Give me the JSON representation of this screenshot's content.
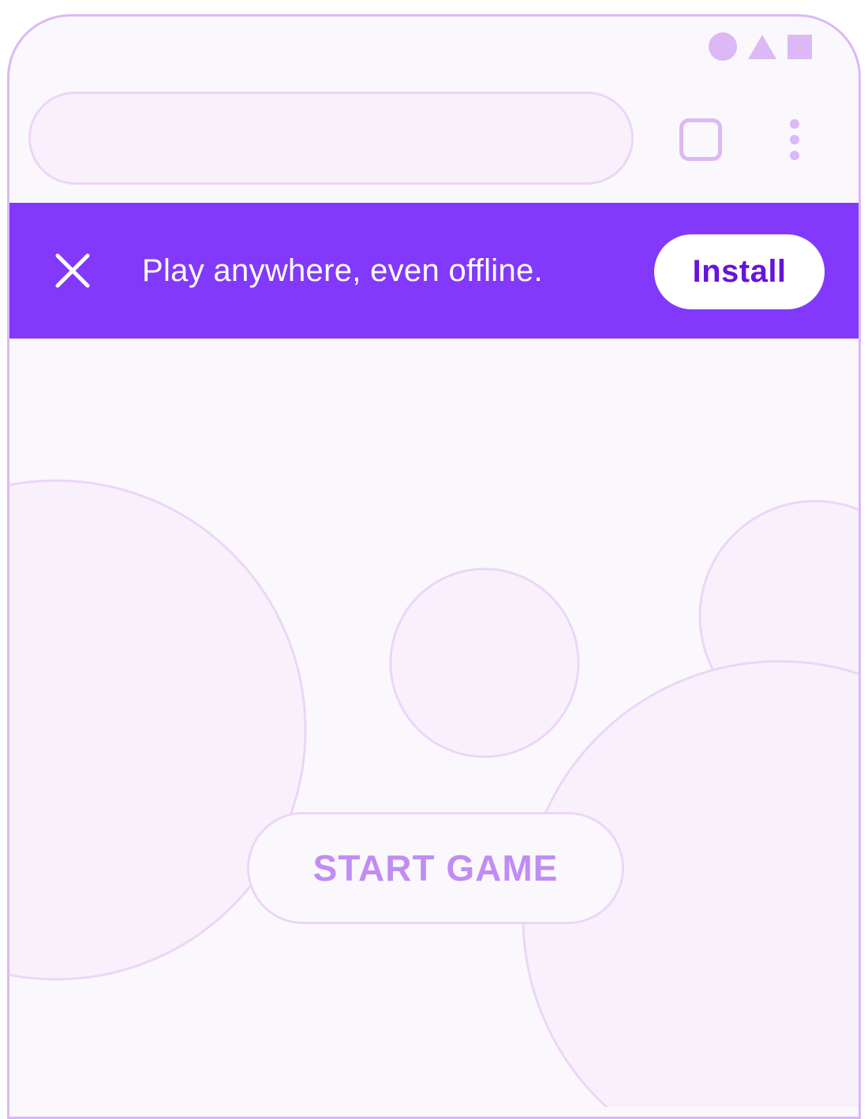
{
  "banner": {
    "message": "Play anywhere, even offline.",
    "install_label": "Install",
    "close_icon": "close-icon"
  },
  "toolbar": {
    "url": "",
    "tabs_icon": "tabs-icon",
    "menu_icon": "more-vert-icon"
  },
  "status_bar": {
    "icons": [
      "circle-icon",
      "triangle-icon",
      "square-icon"
    ]
  },
  "game": {
    "start_label": "START GAME"
  },
  "colors": {
    "accent": "#8239fb",
    "install_text": "#6714d9",
    "outline": "#dcb8f6",
    "start_text": "#c08df3"
  }
}
